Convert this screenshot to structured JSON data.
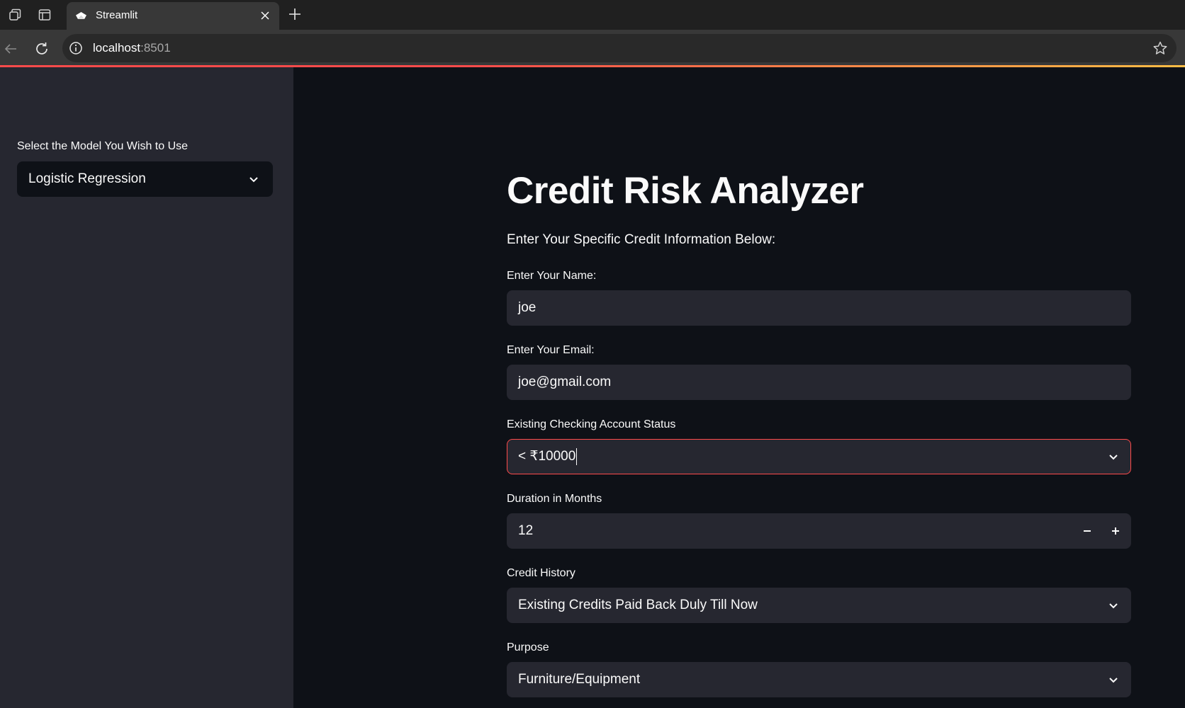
{
  "browser": {
    "tab_title": "Streamlit",
    "url_host": "localhost",
    "url_port": ":8501"
  },
  "sidebar": {
    "model_label": "Select the Model You Wish to Use",
    "model_value": "Logistic Regression"
  },
  "main": {
    "title": "Credit Risk Analyzer",
    "subtitle": "Enter Your Specific Credit Information Below:",
    "name": {
      "label": "Enter Your Name:",
      "value": "joe"
    },
    "email": {
      "label": "Enter Your Email:",
      "value": "joe@gmail.com"
    },
    "checking": {
      "label": "Existing Checking Account Status",
      "value": "< ₹10000"
    },
    "duration": {
      "label": "Duration in Months",
      "value": "12",
      "decrement": "−",
      "increment": "+"
    },
    "credit_history": {
      "label": "Credit History",
      "value": "Existing Credits Paid Back Duly Till Now"
    },
    "purpose": {
      "label": "Purpose",
      "value": "Furniture/Equipment"
    }
  },
  "colors": {
    "background": "#0e1117",
    "sidebar": "#262730",
    "input": "#262730",
    "accent": "#ff4b4b",
    "text": "#fafafa"
  },
  "icons": [
    "tab-actions-icon",
    "vertical-tabs-icon",
    "streamlit-favicon",
    "close-icon",
    "plus-icon",
    "back-arrow-icon",
    "refresh-icon",
    "info-icon",
    "star-icon",
    "chevron-down-icon",
    "minus-icon"
  ]
}
